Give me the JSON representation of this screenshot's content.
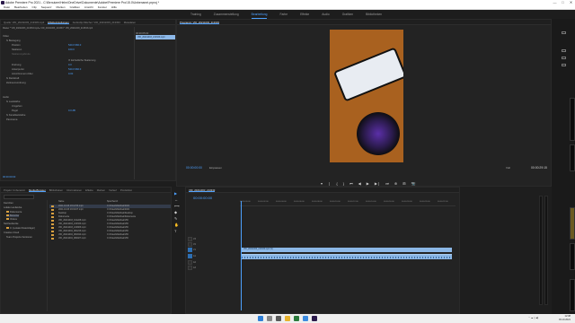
{
  "window": {
    "title": "Adobe Premiere Pro 2021 - C:\\Benutzer\\Helm\\OneDrive\\Dokumente\\Adobe\\Premiere Pro\\15.0\\Unbenannt.prproj *",
    "controls": [
      "—",
      "□",
      "✕"
    ]
  },
  "menu": [
    "Datei",
    "Bearbeiten",
    "Clip",
    "Sequenz",
    "Marken",
    "Grafiken",
    "Ansicht",
    "Fenster",
    "Hilfe"
  ],
  "workspaces": [
    {
      "label": "Training",
      "active": false
    },
    {
      "label": "Zusammenstellung",
      "active": false
    },
    {
      "label": "Bearbeitung",
      "active": true
    },
    {
      "label": "Farbe",
      "active": false
    },
    {
      "label": "Effekte",
      "active": false
    },
    {
      "label": "Audio",
      "active": false
    },
    {
      "label": "Grafiken",
      "active": false
    },
    {
      "label": "Bibliotheken",
      "active": false
    }
  ],
  "effect_controls": {
    "tabs": [
      "Quelle: VID_20211003_213333.mp4",
      "Effekteinstellungen",
      "Audioclip-Mischer: VID_20211003_213333",
      "Metadaten"
    ],
    "source_line": "Master * VID_20211003_213333.mp4 ▸ VID_20211003_213333 * VID_20211003_213333.mp4",
    "clip_label": "VID_20211003_213333.mp4",
    "timecode": "00:00:05:00",
    "rows": [
      {
        "label": "Video",
        "value": ""
      },
      {
        "label": "fx Bewegung",
        "value": ""
      },
      {
        "label": "Position",
        "value": "540.0    960.0"
      },
      {
        "label": "Skalieren",
        "value": "100.0"
      },
      {
        "label": "Skalierungsbreite",
        "value": ""
      },
      {
        "label": "",
        "value": "☑ Einheitliche Skalierung"
      },
      {
        "label": "Drehung",
        "value": "0.0"
      },
      {
        "label": "Ankerpunkt",
        "value": "540.0    960.0"
      },
      {
        "label": "Anti-Flimmern-Filter",
        "value": "0.00"
      },
      {
        "label": "fx Deckkraft",
        "value": ""
      },
      {
        "label": "Zeitneuzuordnung",
        "value": ""
      },
      {
        "label": "Audio",
        "value": ""
      },
      {
        "label": "fx Lautstärke",
        "value": ""
      },
      {
        "label": "Umgehen",
        "value": ""
      },
      {
        "label": "Pegel",
        "value": "0.0 dB"
      },
      {
        "label": "fx Kanallautstärke",
        "value": ""
      },
      {
        "label": "Panorama",
        "value": ""
      }
    ],
    "footer_time": "00:00:00:00"
  },
  "program": {
    "tab": "Programm: VID_20211003_213333",
    "timecode": "00:00:00:00",
    "fit": "Einpassen",
    "quality": "Voll",
    "duration": "00:00:29:15",
    "transport": [
      "▾",
      "❘",
      "{",
      "}",
      "⏮",
      "◀",
      "▶",
      "▶❘",
      "⏭",
      "⊕",
      "⊞",
      "📷"
    ]
  },
  "project": {
    "tabs": [
      "Projekt: Unbenannt",
      "Media-Browser",
      "Bibliotheken",
      "Informationen",
      "Effekte",
      "Marken",
      "Verlauf",
      "Produktion"
    ],
    "favorites": "Favoriten",
    "bins": [
      "Lokale Laufwerke",
      "Dokumente",
      "Benutzer",
      "Videos",
      "Netzlaufwerke",
      "C: (Lokaler Datenträger)",
      "Creative Cloud",
      "Team Projects-Versionen"
    ],
    "columns": [
      "Name",
      "Speicherort"
    ],
    "files": [
      {
        "name": "2021-10-03 19:12:53.mp4",
        "path": "C:\\Videobibliothek\\2021",
        "selected": true
      },
      {
        "name": "2021-10-03 19:19:07.mp4",
        "path": "C:\\Videobibliothek\\2021",
        "selected": false
      },
      {
        "name": "Desktop",
        "path": "C:\\Videobibliothek\\Desktop",
        "selected": false
      },
      {
        "name": "Dokumente",
        "path": "C:\\Videobibliothek\\Dokumente",
        "selected": false
      },
      {
        "name": "VID_20211003_191228.mp4",
        "path": "C:\\Videobibliothek\\VID",
        "selected": false
      },
      {
        "name": "VID_20211003_213333.mp4",
        "path": "C:\\Videobibliothek\\VID",
        "selected": false
      },
      {
        "name": "VID_20211003_213905.mp4",
        "path": "C:\\Videobibliothek\\VID",
        "selected": false
      },
      {
        "name": "VID_20211004_081215.mp4",
        "path": "C:\\Videobibliothek\\VID",
        "selected": false
      },
      {
        "name": "VID_20211004_081910.mp4",
        "path": "C:\\Videobibliothek\\VID",
        "selected": false
      },
      {
        "name": "VID_20211004_082027.mp4",
        "path": "C:\\Videobibliothek\\VID",
        "selected": false
      }
    ]
  },
  "timeline": {
    "tab": "VID_20211003_213333",
    "timecode": "00:00:00:00",
    "ruler": [
      "00:00:00:00",
      "00:00:02:00",
      "00:00:04:00",
      "00:00:06:00",
      "00:00:08:00",
      "00:00:10:00",
      "00:00:12:00",
      "00:00:14:00",
      "00:00:16:00",
      "00:00:18:00",
      "00:00:20:00",
      "00:00:22:00"
    ],
    "tracks": [
      "V3",
      "V2",
      "V1",
      "A1",
      "A2",
      "A3"
    ],
    "video_clip": "VID_20211003_213333.mp4 [V]",
    "audio_clip": ""
  },
  "tools": [
    "▶",
    "↔",
    "⟷",
    "◆",
    "✎",
    "✋",
    "T"
  ],
  "taskbar": {
    "time": "12:38",
    "date": "03.10.2021"
  },
  "colors": {
    "accent": "#4da1ff",
    "clip": "#8bb7e6",
    "bin": "#d8a040"
  }
}
